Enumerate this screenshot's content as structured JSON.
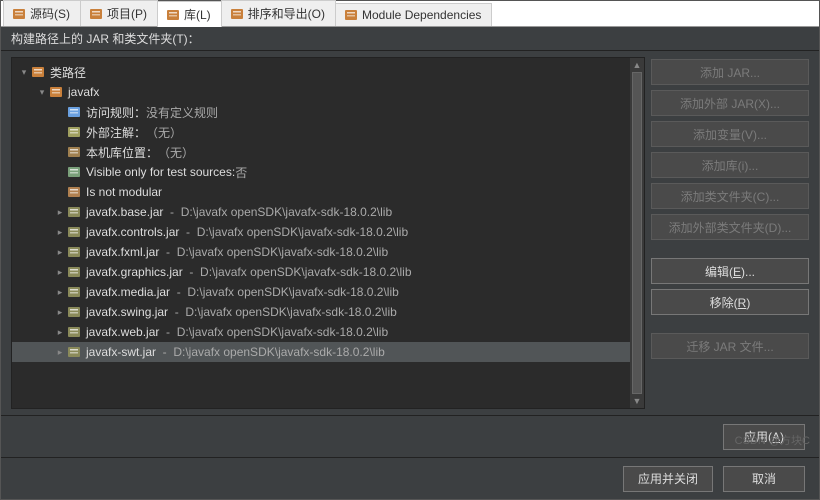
{
  "tabs": [
    {
      "label": "源码(S)",
      "icon": "source-icon",
      "active": false
    },
    {
      "label": "项目(P)",
      "icon": "projects-icon",
      "active": false
    },
    {
      "label": "库(L)",
      "icon": "libraries-icon",
      "active": true
    },
    {
      "label": "排序和导出(O)",
      "icon": "order-icon",
      "active": false
    },
    {
      "label": "Module Dependencies",
      "icon": "module-icon",
      "active": false
    }
  ],
  "subheader": "构建路径上的 JAR 和类文件夹(T)：",
  "tree": {
    "root": {
      "label": "类路径",
      "expanded": true
    },
    "lib": {
      "label": "javafx",
      "expanded": true
    },
    "props": [
      {
        "label": "访问规则：",
        "value": "没有定义规则",
        "icon": "access-icon"
      },
      {
        "label": "外部注解：",
        "value": "（无）",
        "icon": "annotation-icon"
      },
      {
        "label": "本机库位置：",
        "value": "（无）",
        "icon": "native-icon"
      },
      {
        "label": "Visible only for test sources: ",
        "value": "否",
        "icon": "eye-icon"
      },
      {
        "label": "Is not modular",
        "value": "",
        "icon": "module-flag-icon"
      }
    ],
    "jars": [
      {
        "name": "javafx.base.jar",
        "path": "D:\\javafx openSDK\\javafx-sdk-18.0.2\\lib"
      },
      {
        "name": "javafx.controls.jar",
        "path": "D:\\javafx openSDK\\javafx-sdk-18.0.2\\lib"
      },
      {
        "name": "javafx.fxml.jar",
        "path": "D:\\javafx openSDK\\javafx-sdk-18.0.2\\lib"
      },
      {
        "name": "javafx.graphics.jar",
        "path": "D:\\javafx openSDK\\javafx-sdk-18.0.2\\lib"
      },
      {
        "name": "javafx.media.jar",
        "path": "D:\\javafx openSDK\\javafx-sdk-18.0.2\\lib"
      },
      {
        "name": "javafx.swing.jar",
        "path": "D:\\javafx openSDK\\javafx-sdk-18.0.2\\lib"
      },
      {
        "name": "javafx.web.jar",
        "path": "D:\\javafx openSDK\\javafx-sdk-18.0.2\\lib"
      },
      {
        "name": "javafx-swt.jar",
        "path": "D:\\javafx openSDK\\javafx-sdk-18.0.2\\lib",
        "highlighted": true
      }
    ]
  },
  "buttons": {
    "add_jar": "添加 JAR...",
    "add_ext_jar": "添加外部 JAR(X)...",
    "add_var": "添加变量(V)...",
    "add_lib": "添加库(i)...",
    "add_class_folder": "添加类文件夹(C)...",
    "add_ext_class_folder": "添加外部类文件夹(D)...",
    "edit": "编辑(E)...",
    "remove": "移除(R)",
    "migrate": "迁移 JAR 文件..."
  },
  "footer": {
    "apply": "应用(A)",
    "apply_close": "应用并关闭",
    "cancel": "取消"
  },
  "watermark": "CSDN @方块C"
}
